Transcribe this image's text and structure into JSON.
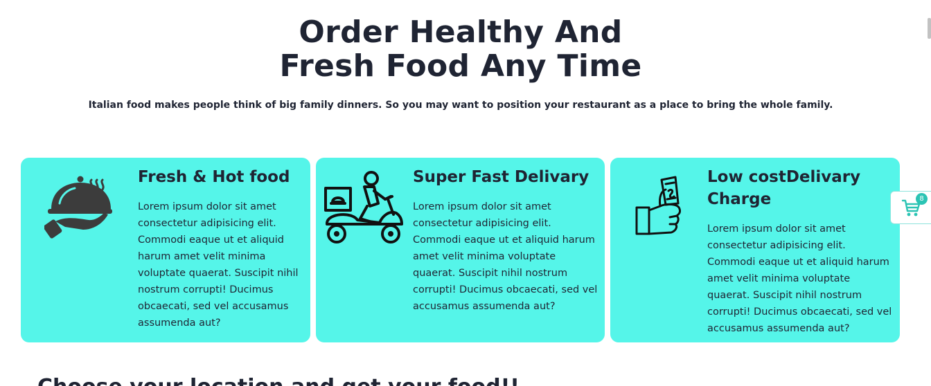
{
  "hero": {
    "title_line1": "Order Healthy And",
    "title_line2": "Fresh Food Any Time",
    "subtitle": "Italian food makes people think of big family dinners. So you may want to position your restaurant as a place to bring the whole family."
  },
  "features": [
    {
      "icon": "serving-tray-icon",
      "title": "Fresh & Hot food",
      "text": "Lorem ipsum dolor sit amet consectetur adipisicing elit. Commodi eaque ut et aliquid harum amet velit minima voluptate quaerat. Suscipit nihil nostrum corrupti! Ducimus obcaecati, sed vel accusamus assumenda aut?"
    },
    {
      "icon": "delivery-scooter-icon",
      "title": "Super Fast Delivary",
      "text": "Lorem ipsum dolor sit amet consectetur adipisicing elit. Commodi eaque ut et aliquid harum amet velit minima voluptate quaerat. Suscipit nihil nostrum corrupti! Ducimus obcaecati, sed vel accusamus assumenda aut?"
    },
    {
      "icon": "hand-money-icon",
      "title": "Low costDelivary Charge",
      "text": "Lorem ipsum dolor sit amet consectetur adipisicing elit. Commodi eaque ut et aliquid harum amet velit minima voluptate quaerat. Suscipit nihil nostrum corrupti! Ducimus obcaecati, sed vel accusamus assumenda aut?"
    }
  ],
  "cart": {
    "icon": "shopping-cart-icon",
    "count": "8"
  },
  "next_section": {
    "heading": "Choose your location and get your food!!"
  },
  "colors": {
    "card_bg": "#55f5e9",
    "text_dark": "#1f2433",
    "badge": "#2bc4b4"
  }
}
